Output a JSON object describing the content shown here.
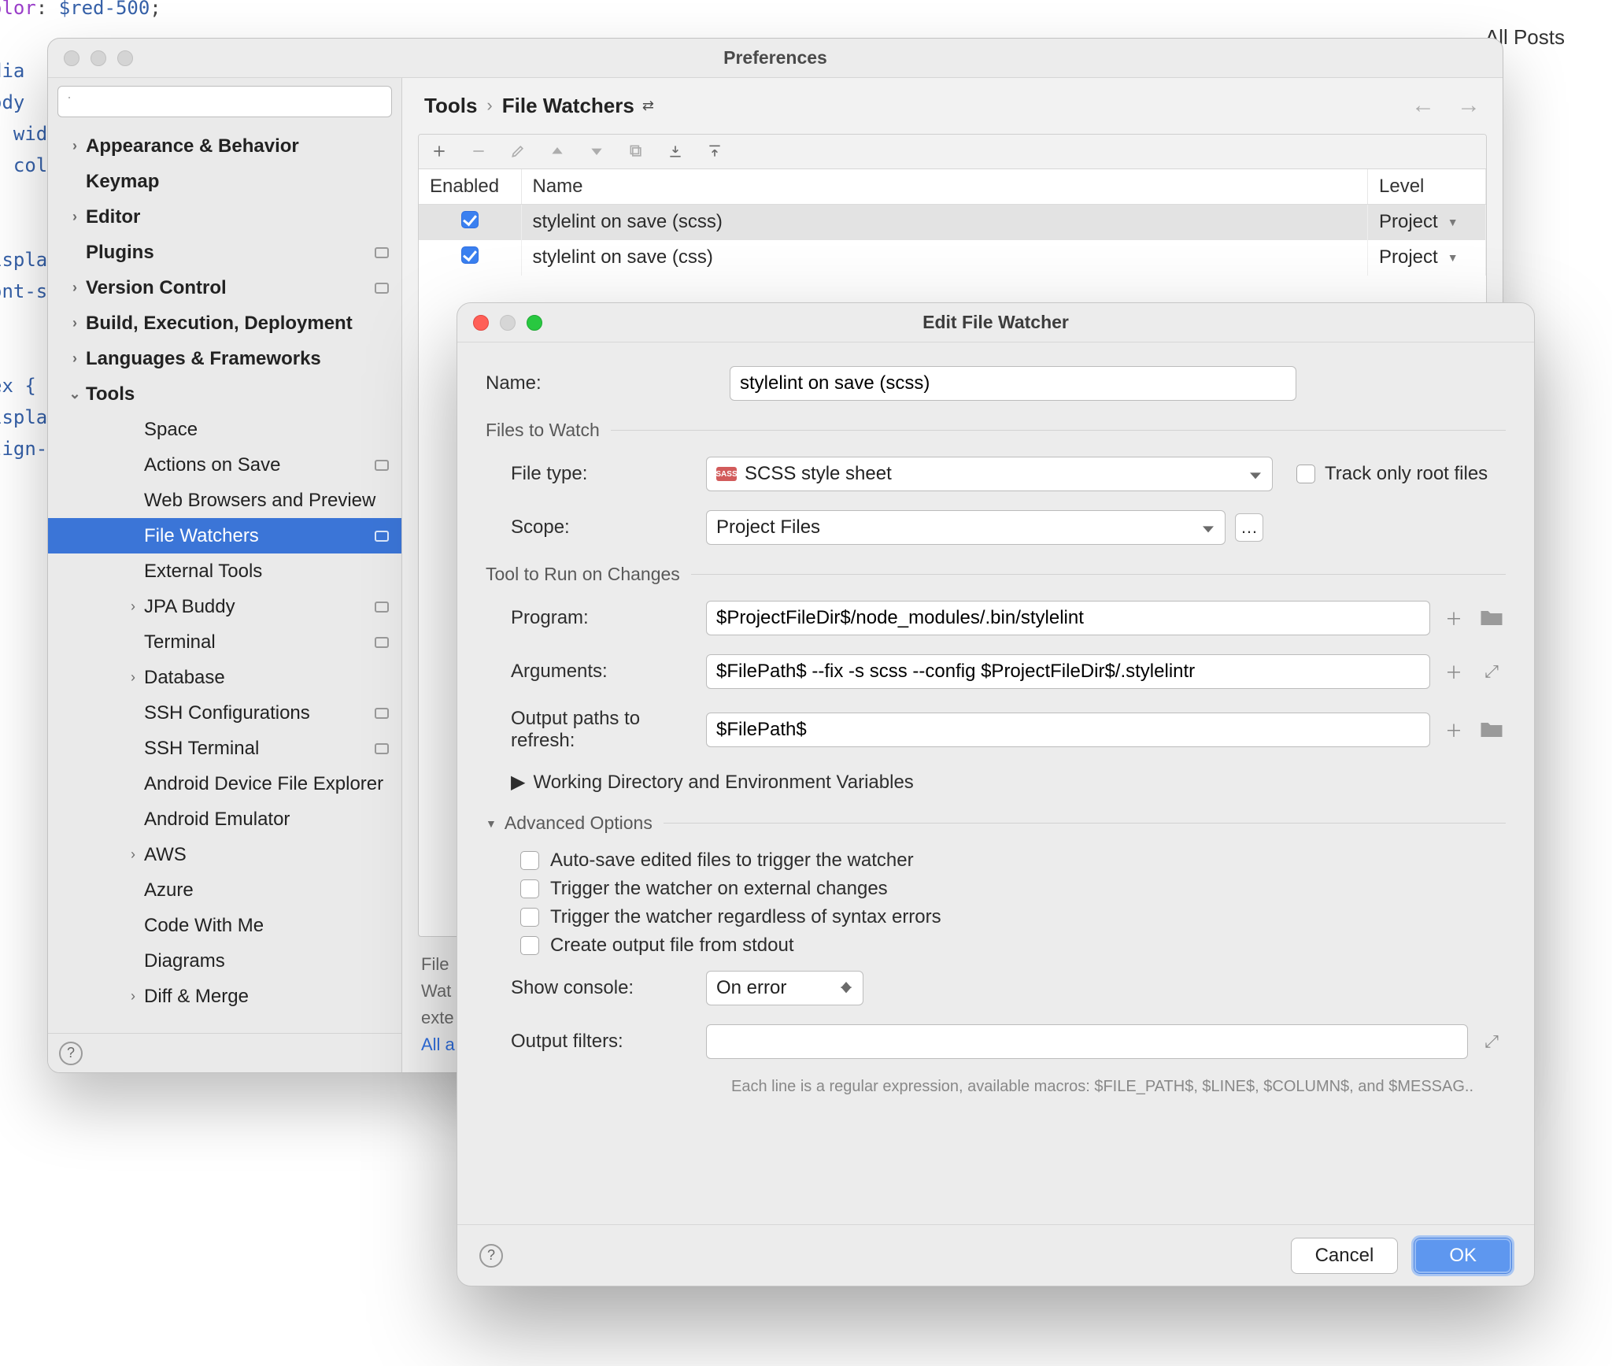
{
  "bg_right": "All Posts",
  "prefs": {
    "title": "Preferences",
    "crumb": {
      "tools": "Tools",
      "current": "File Watchers"
    },
    "sidebar": [
      {
        "label": "Appearance & Behavior",
        "bold": true,
        "arrow": ">"
      },
      {
        "label": "Keymap",
        "bold": true
      },
      {
        "label": "Editor",
        "bold": true,
        "arrow": ">"
      },
      {
        "label": "Plugins",
        "bold": true,
        "tag": true
      },
      {
        "label": "Version Control",
        "bold": true,
        "arrow": ">",
        "tag": true
      },
      {
        "label": "Build, Execution, Deployment",
        "bold": true,
        "arrow": ">"
      },
      {
        "label": "Languages & Frameworks",
        "bold": true,
        "arrow": ">"
      },
      {
        "label": "Tools",
        "bold": true,
        "arrow": "v"
      },
      {
        "label": "Space",
        "indent": 2
      },
      {
        "label": "Actions on Save",
        "indent": 2,
        "tag": true
      },
      {
        "label": "Web Browsers and Preview",
        "indent": 2
      },
      {
        "label": "File Watchers",
        "indent": 2,
        "selected": true,
        "tag": true
      },
      {
        "label": "External Tools",
        "indent": 2
      },
      {
        "label": "JPA Buddy",
        "indent": 2,
        "arrow": ">",
        "tag": true
      },
      {
        "label": "Terminal",
        "indent": 2,
        "tag": true
      },
      {
        "label": "Database",
        "indent": 2,
        "arrow": ">"
      },
      {
        "label": "SSH Configurations",
        "indent": 2,
        "tag": true
      },
      {
        "label": "SSH Terminal",
        "indent": 2,
        "tag": true
      },
      {
        "label": "Android Device File Explorer",
        "indent": 2
      },
      {
        "label": "Android Emulator",
        "indent": 2
      },
      {
        "label": "AWS",
        "indent": 2,
        "arrow": ">"
      },
      {
        "label": "Azure",
        "indent": 2
      },
      {
        "label": "Code With Me",
        "indent": 2
      },
      {
        "label": "Diagrams",
        "indent": 2
      },
      {
        "label": "Diff & Merge",
        "indent": 2,
        "arrow": ">"
      }
    ],
    "table": {
      "headers": {
        "enabled": "Enabled",
        "name": "Name",
        "level": "Level"
      },
      "rows": [
        {
          "enabled": true,
          "name": "stylelint on save (scss)",
          "level": "Project",
          "selected": true
        },
        {
          "enabled": true,
          "name": "stylelint on save (css)",
          "level": "Project"
        }
      ]
    },
    "hint_lines": [
      "File",
      "Wat",
      "exte"
    ],
    "hint_link": "All a"
  },
  "dialog": {
    "title": "Edit File Watcher",
    "labels": {
      "name": "Name:",
      "files_to_watch": "Files to Watch",
      "file_type": "File type:",
      "scope": "Scope:",
      "track_root": "Track only root files",
      "tool_section": "Tool to Run on Changes",
      "program": "Program:",
      "arguments": "Arguments:",
      "output_paths": "Output paths to refresh:",
      "working_dir": "Working Directory and Environment Variables",
      "advanced": "Advanced Options",
      "cb1": "Auto-save edited files to trigger the watcher",
      "cb2": "Trigger the watcher on external changes",
      "cb3": "Trigger the watcher regardless of syntax errors",
      "cb4": "Create output file from stdout",
      "show_console": "Show console:",
      "output_filters": "Output filters:",
      "macros_note": "Each line is a regular expression, available macros: $FILE_PATH$, $LINE$, $COLUMN$, and $MESSAG..",
      "cancel": "Cancel",
      "ok": "OK"
    },
    "values": {
      "name": "stylelint on save (scss)",
      "file_type": "SCSS style sheet",
      "scope": "Project Files",
      "program": "$ProjectFileDir$/node_modules/.bin/stylelint",
      "arguments": "$FilePath$ --fix -s scss --config $ProjectFileDir$/.stylelintr",
      "output_paths": "$FilePath$",
      "show_console": "On error"
    }
  }
}
